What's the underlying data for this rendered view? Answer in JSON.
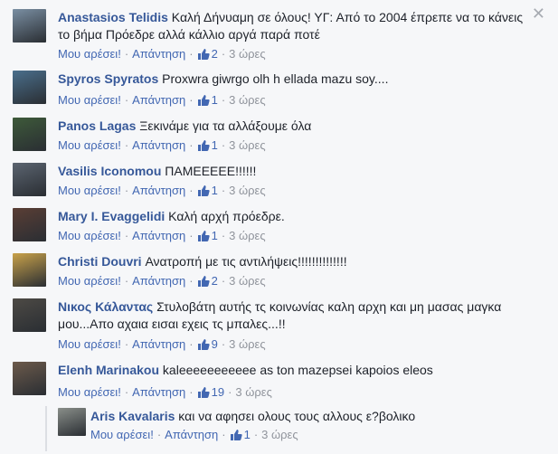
{
  "close_glyph": "✕",
  "like_label": "Μου αρέσει!",
  "reply_label": "Απάντηση",
  "separator": "·",
  "comments": [
    {
      "name": "Anastasios Telidis",
      "text": "Καλή Δήνυαμη σε όλους! ΥΓ: Από το 2004 έπρεπε να το κάνεις το βήμα Πρόεδρε αλλά κάλλιο αργά παρά ποτέ",
      "likes": "2",
      "time": "3 ώρες",
      "avatar_color": "#7a8fa3"
    },
    {
      "name": "Spyros Spyratos",
      "text": "Proxwra giwrgo olh h ellada mazu soy....",
      "likes": "1",
      "time": "3 ώρες",
      "avatar_color": "#4a6f8c"
    },
    {
      "name": "Panos Lagas",
      "text": "Ξεκινάμε για τα αλλάξουμε όλα",
      "likes": "1",
      "time": "3 ώρες",
      "avatar_color": "#3e5a3a"
    },
    {
      "name": "Vasilis Iconomou",
      "text": "ΠΑΜΕΕΕΕΕ!!!!!!",
      "likes": "1",
      "time": "3 ώρες",
      "avatar_color": "#5b6470"
    },
    {
      "name": "Mary I. Evaggelidi",
      "text": "Καλή αρχή πρόεδρε.",
      "likes": "1",
      "time": "3 ώρες",
      "avatar_color": "#5a3e35"
    },
    {
      "name": "Christi Douvri",
      "text": "Ανατροπή με τις αντιλήψεις!!!!!!!!!!!!!!",
      "likes": "2",
      "time": "3 ώρες",
      "avatar_color": "#c9a24a"
    },
    {
      "name": "Νικος Κάλαντας",
      "text": "Στυλοβάτη αυτής τς κοινωνίας καλη αρχη και μη μασας μαγκα μου...Απο αχαια εισαι εχεις τς μπαλες...!!",
      "likes": "9",
      "time": "3 ώρες",
      "avatar_color": "#4d4a45"
    },
    {
      "name": "Elenh Marinakou",
      "text": "kaleeeeeeeeeee as ton mazepsei kapoios eleos",
      "likes": "19",
      "time": "3 ώρες",
      "avatar_color": "#6c5a4b"
    }
  ],
  "reply": {
    "name": "Aris Kavalaris",
    "text": "και να αφησει ολους τους αλλους ε?βολικο",
    "likes": "1",
    "time": "3 ώρες",
    "avatar_color": "#8a8f8a"
  }
}
